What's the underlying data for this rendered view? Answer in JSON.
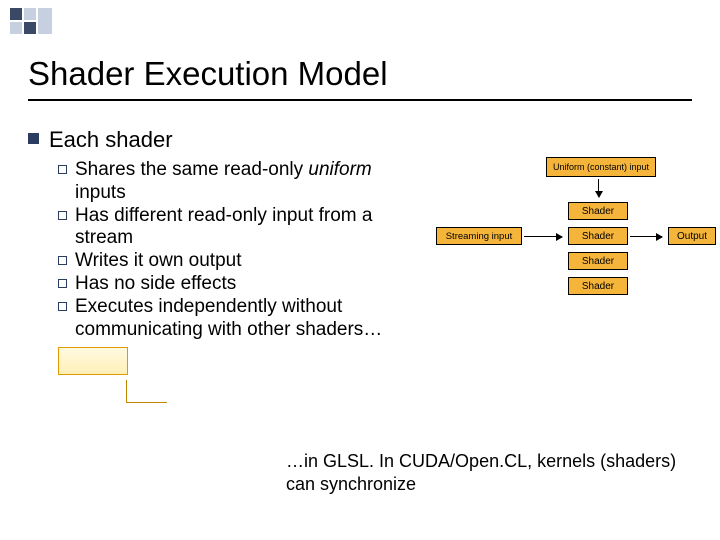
{
  "title": "Shader Execution Model",
  "l1": "Each shader",
  "items": {
    "a_pre": "Shares the same read-only ",
    "a_em": "uniform",
    "a_post": " inputs",
    "b": "Has different read-only input from a stream",
    "c": "Writes it own output",
    "d": "Has no side effects",
    "e": "Executes independently without communicating with other shaders…"
  },
  "diagram": {
    "uniform": "Uniform (constant) input",
    "shader": "Shader",
    "streaming": "Streaming input",
    "output": "Output"
  },
  "footnote": "…in GLSL.  In CUDA/Open.CL, kernels (shaders) can synchronize"
}
